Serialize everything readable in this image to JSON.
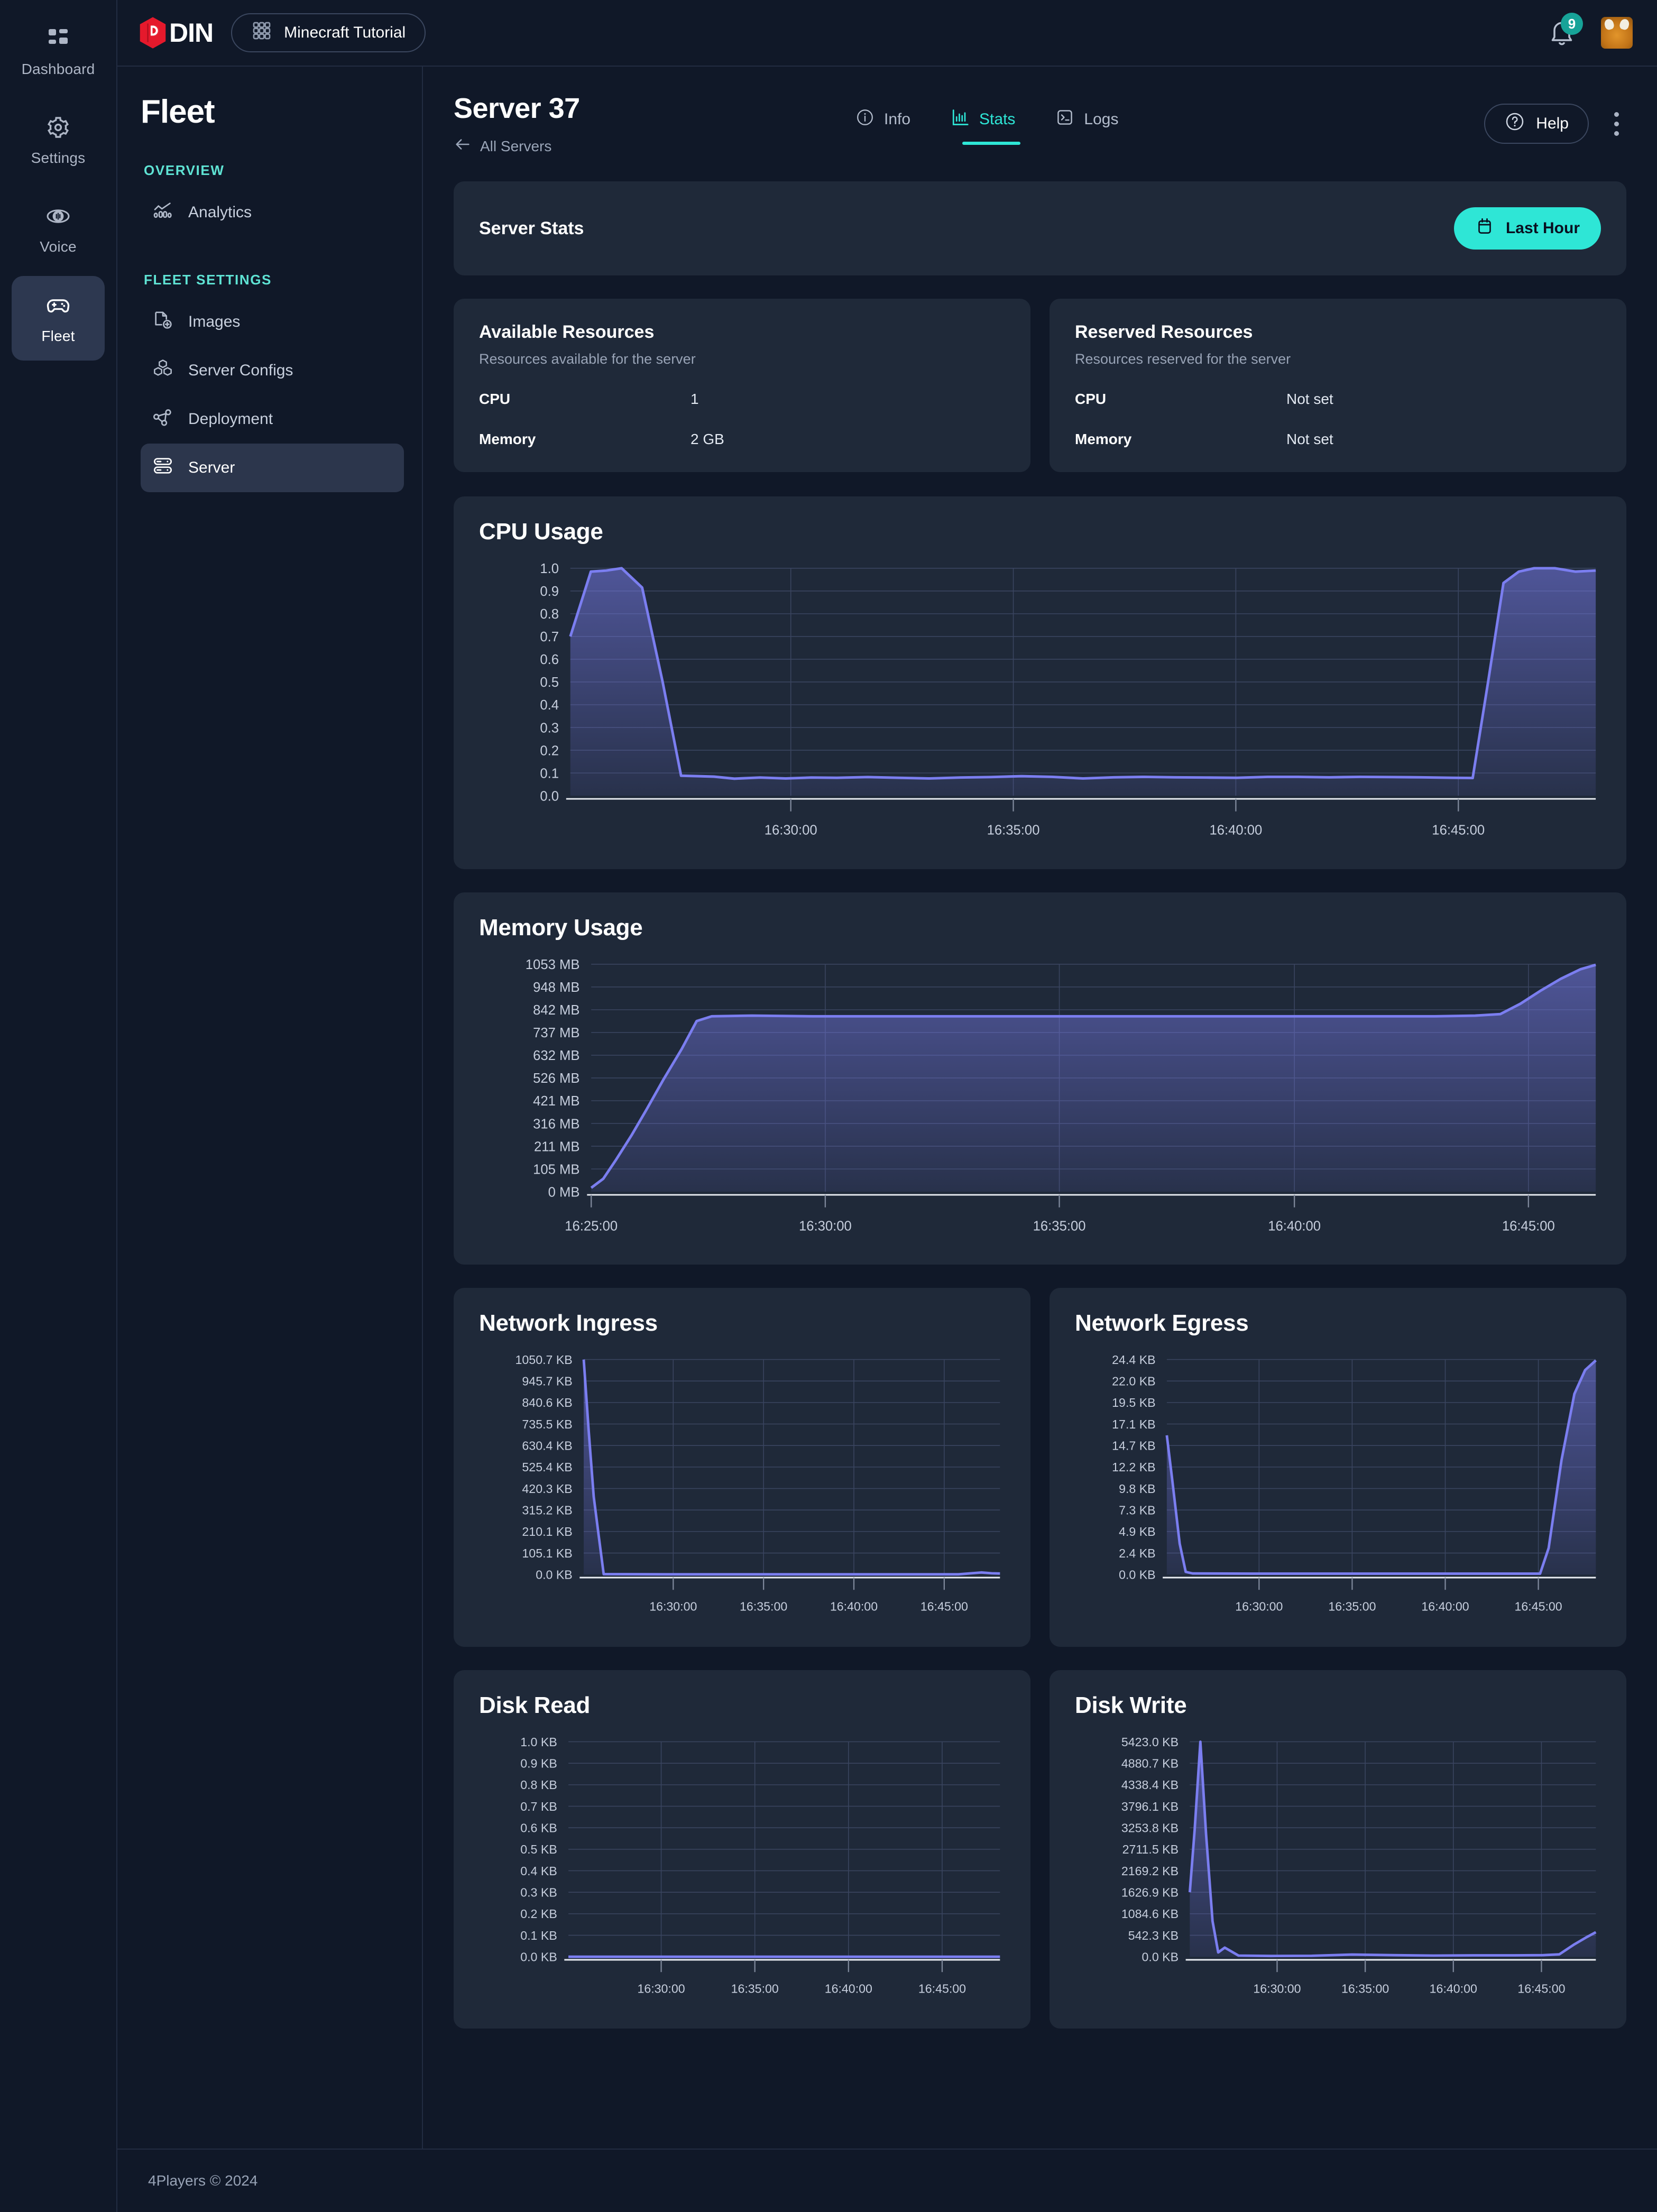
{
  "brand": {
    "logo_text": "DIN",
    "accent": "#2EE6D6",
    "line_color": "#7b7ef0"
  },
  "topbar": {
    "project_label": "Minecraft Tutorial",
    "grid_icon": "grid-icon",
    "notification_count": "9",
    "bell_icon": "bell-icon",
    "avatar_icon": "user-avatar"
  },
  "rail": {
    "items": [
      {
        "label": "Dashboard",
        "icon": "dashboard-icon",
        "active": false
      },
      {
        "label": "Settings",
        "icon": "gear-icon",
        "active": false
      },
      {
        "label": "Voice",
        "icon": "voice-icon",
        "active": false
      },
      {
        "label": "Fleet",
        "icon": "gamepad-icon",
        "active": true
      }
    ]
  },
  "sidebar": {
    "title": "Fleet",
    "section_overview": "OVERVIEW",
    "section_fleet_settings": "FLEET SETTINGS",
    "overview_items": [
      {
        "label": "Analytics",
        "icon": "analytics-icon",
        "active": false
      }
    ],
    "fleet_items": [
      {
        "label": "Images",
        "icon": "image-plus-icon",
        "active": false
      },
      {
        "label": "Server Configs",
        "icon": "cubes-icon",
        "active": false
      },
      {
        "label": "Deployment",
        "icon": "deployment-icon",
        "active": false
      },
      {
        "label": "Server",
        "icon": "server-icon",
        "active": true
      }
    ]
  },
  "page": {
    "title": "Server 37",
    "back_label": "All Servers",
    "back_icon": "arrow-left-icon",
    "tabs": [
      {
        "label": "Info",
        "icon": "info-icon",
        "active": false
      },
      {
        "label": "Stats",
        "icon": "bar-chart-icon",
        "active": true
      },
      {
        "label": "Logs",
        "icon": "terminal-icon",
        "active": false
      }
    ],
    "help_label": "Help",
    "help_icon": "question-circle-icon",
    "more_icon": "kebab-menu-icon"
  },
  "stats_bar": {
    "title": "Server Stats",
    "range_label": "Last Hour",
    "range_icon": "calendar-icon"
  },
  "resources": {
    "available": {
      "title": "Available Resources",
      "subtitle": "Resources available for the server",
      "rows": [
        {
          "key": "CPU",
          "value": "1"
        },
        {
          "key": "Memory",
          "value": "2 GB"
        }
      ]
    },
    "reserved": {
      "title": "Reserved Resources",
      "subtitle": "Resources reserved for the server",
      "rows": [
        {
          "key": "CPU",
          "value": "Not set"
        },
        {
          "key": "Memory",
          "value": "Not set"
        }
      ]
    }
  },
  "footer": {
    "copyright": "4Players © 2024"
  },
  "chart_data": [
    {
      "id": "cpu",
      "type": "area",
      "title": "CPU Usage",
      "xlabel": "",
      "ylabel": "",
      "grid": true,
      "legend": "none",
      "ytick_labels": [
        "1.0",
        "0.9",
        "0.8",
        "0.7",
        "0.6",
        "0.5",
        "0.4",
        "0.3",
        "0.2",
        "0.1",
        "0.0"
      ],
      "ylim": [
        0,
        1.0
      ],
      "xtick_labels": [
        "16:30:00",
        "16:35:00",
        "16:40:00",
        "16:45:00"
      ],
      "xtick_positions": [
        0.215,
        0.432,
        0.649,
        0.866
      ],
      "x": [
        0.0,
        0.02,
        0.035,
        0.05,
        0.07,
        0.09,
        0.108,
        0.125,
        0.14,
        0.16,
        0.185,
        0.21,
        0.235,
        0.26,
        0.29,
        0.32,
        0.35,
        0.38,
        0.41,
        0.44,
        0.47,
        0.5,
        0.53,
        0.56,
        0.59,
        0.62,
        0.65,
        0.68,
        0.71,
        0.74,
        0.77,
        0.8,
        0.83,
        0.86,
        0.88,
        0.895,
        0.91,
        0.925,
        0.94,
        0.96,
        0.98,
        1.0
      ],
      "values": [
        0.7,
        0.985,
        0.99,
        1.0,
        0.915,
        0.5,
        0.088,
        0.086,
        0.084,
        0.075,
        0.08,
        0.076,
        0.08,
        0.079,
        0.082,
        0.079,
        0.076,
        0.08,
        0.082,
        0.086,
        0.083,
        0.076,
        0.081,
        0.083,
        0.081,
        0.08,
        0.079,
        0.083,
        0.083,
        0.081,
        0.083,
        0.082,
        0.081,
        0.079,
        0.078,
        0.5,
        0.935,
        0.985,
        1.0,
        1.0,
        0.985,
        0.99
      ]
    },
    {
      "id": "memory",
      "type": "area",
      "title": "Memory Usage",
      "xlabel": "",
      "ylabel": "",
      "grid": true,
      "legend": "none",
      "ytick_labels": [
        "1053 MB",
        "948 MB",
        "842 MB",
        "737 MB",
        "632 MB",
        "526 MB",
        "421 MB",
        "316 MB",
        "211 MB",
        "105 MB",
        "0 MB"
      ],
      "ylim": [
        0,
        1053
      ],
      "xtick_labels": [
        "16:25:00",
        "16:30:00",
        "16:35:00",
        "16:40:00",
        "16:45:00"
      ],
      "xtick_positions": [
        0.0,
        0.233,
        0.466,
        0.7,
        0.933
      ],
      "x": [
        0.0,
        0.012,
        0.025,
        0.04,
        0.055,
        0.072,
        0.09,
        0.105,
        0.12,
        0.16,
        0.22,
        0.3,
        0.4,
        0.5,
        0.6,
        0.7,
        0.78,
        0.84,
        0.88,
        0.905,
        0.925,
        0.945,
        0.965,
        0.985,
        1.0
      ],
      "values": [
        18,
        60,
        150,
        260,
        380,
        520,
        660,
        790,
        812,
        815,
        812,
        812,
        812,
        812,
        812,
        812,
        812,
        812,
        815,
        822,
        870,
        930,
        985,
        1030,
        1050
      ]
    },
    {
      "id": "network_ingress",
      "type": "area",
      "title": "Network Ingress",
      "xlabel": "",
      "ylabel": "",
      "grid": true,
      "legend": "none",
      "ytick_labels": [
        "1050.7 KB",
        "945.7 KB",
        "840.6 KB",
        "735.5 KB",
        "630.4 KB",
        "525.4 KB",
        "420.3 KB",
        "315.2 KB",
        "210.1 KB",
        "105.1 KB",
        "0.0 KB"
      ],
      "ylim": [
        0,
        1050.7
      ],
      "xtick_labels": [
        "16:30:00",
        "16:35:00",
        "16:40:00",
        "16:45:00"
      ],
      "xtick_positions": [
        0.215,
        0.432,
        0.649,
        0.866
      ],
      "x": [
        0.0,
        0.012,
        0.024,
        0.036,
        0.048,
        0.2,
        0.4,
        0.6,
        0.8,
        0.9,
        0.955,
        0.98,
        1.0
      ],
      "values": [
        1050.7,
        700,
        380,
        190,
        2,
        1,
        1,
        1,
        1,
        1,
        10,
        6,
        5
      ]
    },
    {
      "id": "network_egress",
      "type": "area",
      "title": "Network Egress",
      "xlabel": "",
      "ylabel": "",
      "grid": true,
      "legend": "none",
      "ytick_labels": [
        "24.4 KB",
        "22.0 KB",
        "19.5 KB",
        "17.1 KB",
        "14.7 KB",
        "12.2 KB",
        "9.8 KB",
        "7.3 KB",
        "4.9 KB",
        "2.4 KB",
        "0.0 KB"
      ],
      "ylim": [
        0,
        24.4
      ],
      "xtick_labels": [
        "16:30:00",
        "16:35:00",
        "16:40:00",
        "16:45:00"
      ],
      "xtick_positions": [
        0.215,
        0.432,
        0.649,
        0.866
      ],
      "x": [
        0.0,
        0.012,
        0.03,
        0.044,
        0.06,
        0.2,
        0.4,
        0.6,
        0.8,
        0.87,
        0.89,
        0.92,
        0.95,
        0.975,
        1.0
      ],
      "values": [
        15.8,
        11.0,
        3.5,
        0.3,
        0.12,
        0.1,
        0.1,
        0.1,
        0.1,
        0.1,
        3.0,
        13.0,
        20.5,
        23.2,
        24.3
      ]
    },
    {
      "id": "disk_read",
      "type": "area",
      "title": "Disk Read",
      "xlabel": "",
      "ylabel": "",
      "grid": true,
      "legend": "none",
      "ytick_labels": [
        "1.0 KB",
        "0.9 KB",
        "0.8 KB",
        "0.7 KB",
        "0.6 KB",
        "0.5 KB",
        "0.4 KB",
        "0.3 KB",
        "0.2 KB",
        "0.1 KB",
        "0.0 KB"
      ],
      "ylim": [
        0,
        1.0
      ],
      "xtick_labels": [
        "16:30:00",
        "16:35:00",
        "16:40:00",
        "16:45:00"
      ],
      "xtick_positions": [
        0.215,
        0.432,
        0.649,
        0.866
      ],
      "x": [
        0.0,
        0.25,
        0.5,
        0.75,
        1.0
      ],
      "values": [
        0,
        0,
        0,
        0,
        0
      ]
    },
    {
      "id": "disk_write",
      "type": "area",
      "title": "Disk Write",
      "xlabel": "",
      "ylabel": "",
      "grid": true,
      "legend": "none",
      "ytick_labels": [
        "5423.0 KB",
        "4880.7 KB",
        "4338.4 KB",
        "3796.1 KB",
        "3253.8 KB",
        "2711.5 KB",
        "2169.2 KB",
        "1626.9 KB",
        "1084.6 KB",
        "542.3 KB",
        "0.0 KB"
      ],
      "ylim": [
        0,
        5423.0
      ],
      "xtick_labels": [
        "16:30:00",
        "16:35:00",
        "16:40:00",
        "16:45:00"
      ],
      "xtick_positions": [
        0.215,
        0.432,
        0.649,
        0.866
      ],
      "x": [
        0.0,
        0.012,
        0.026,
        0.04,
        0.056,
        0.07,
        0.086,
        0.12,
        0.2,
        0.3,
        0.4,
        0.5,
        0.6,
        0.7,
        0.8,
        0.87,
        0.91,
        0.945,
        0.975,
        1.0
      ],
      "values": [
        1626.9,
        3200,
        5423,
        3100,
        900,
        110,
        230,
        30,
        20,
        25,
        55,
        40,
        30,
        35,
        35,
        40,
        60,
        300,
        480,
        620
      ]
    }
  ]
}
